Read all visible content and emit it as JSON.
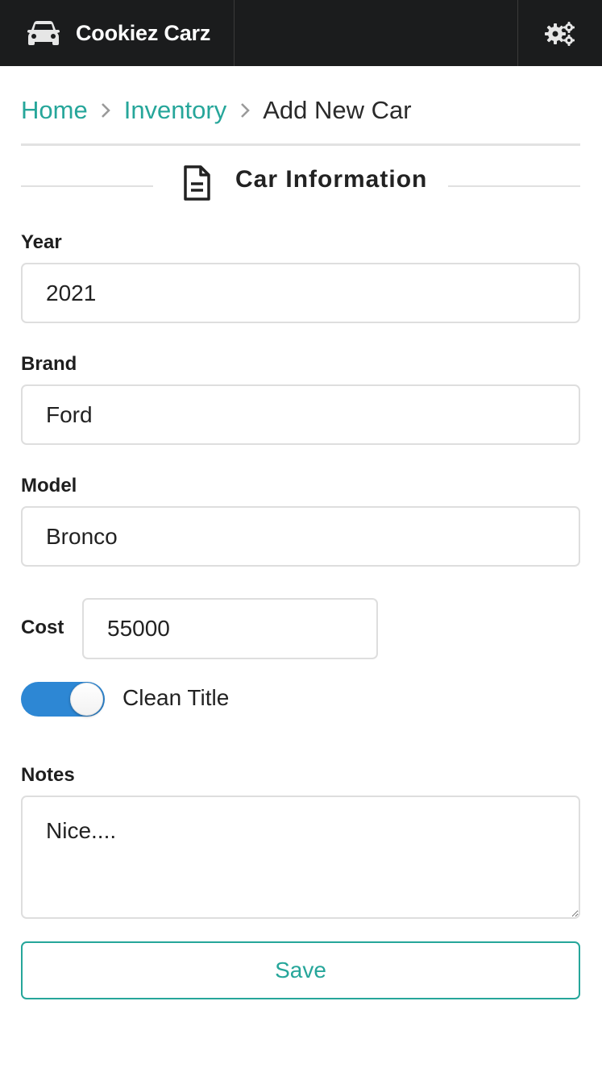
{
  "app": {
    "title": "Cookiez Carz",
    "brand_icon": "car-icon",
    "settings_icon": "gears-icon"
  },
  "breadcrumb": {
    "items": [
      "Home",
      "Inventory",
      "Add New Car"
    ]
  },
  "section": {
    "title": "Car Information",
    "icon": "document-icon"
  },
  "form": {
    "year": {
      "label": "Year",
      "value": "2021"
    },
    "brand": {
      "label": "Brand",
      "value": "Ford"
    },
    "model": {
      "label": "Model",
      "value": "Bronco"
    },
    "cost": {
      "label": "Cost",
      "value": "55000"
    },
    "clean_title": {
      "label": "Clean Title",
      "checked": true
    },
    "notes": {
      "label": "Notes",
      "value": "Nice...."
    },
    "save_label": "Save"
  },
  "colors": {
    "navbar": "#1b1c1d",
    "accent": "#26a69a",
    "toggle_on": "#2d87d4"
  }
}
